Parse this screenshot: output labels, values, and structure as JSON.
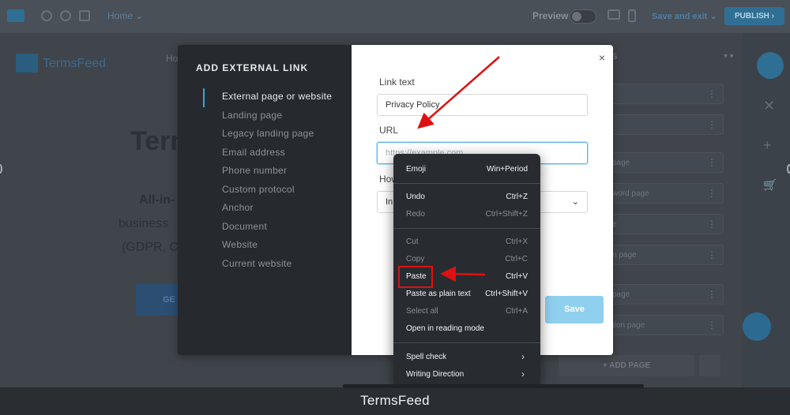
{
  "topbar": {
    "home_label": "Home",
    "preview_label": "Preview",
    "save_exit_label": "Save and exit",
    "publish_label": "PUBLISH"
  },
  "site": {
    "logo_text": "TermsFeed",
    "nav_text": "Ho",
    "hero_title": "Term",
    "hero_sub1": "All-in-",
    "hero_sub2": "business",
    "hero_sub3": "(GDPR, C",
    "hero_button": "GE"
  },
  "pages_panel": {
    "header": "S",
    "items": [
      {
        "label": ""
      },
      {
        "label": ""
      },
      {
        "label": "page"
      },
      {
        "label": "word page"
      },
      {
        "label": "e"
      },
      {
        "label": "n page"
      },
      {
        "label": "page"
      },
      {
        "label": "tion page"
      }
    ],
    "add_page_label": "+ ADD PAGE"
  },
  "modal": {
    "title": "ADD EXTERNAL LINK",
    "nav_items": [
      "External page or website",
      "Landing page",
      "Legacy landing page",
      "Email address",
      "Phone number",
      "Custom protocol",
      "Anchor",
      "Document",
      "Website",
      "Current website"
    ],
    "link_text_label": "Link text",
    "link_text_value": "Privacy Policy",
    "url_label": "URL",
    "url_placeholder": "https://example.com",
    "how_label": "How",
    "how_value": "In",
    "save_label": "Save",
    "close_glyph": "×"
  },
  "context_menu": {
    "items": [
      {
        "label": "Emoji",
        "shortcut": "Win+Period",
        "enabled": true
      },
      {
        "label": "Undo",
        "shortcut": "Ctrl+Z",
        "enabled": true
      },
      {
        "label": "Redo",
        "shortcut": "Ctrl+Shift+Z",
        "enabled": false
      },
      {
        "label": "Cut",
        "shortcut": "Ctrl+X",
        "enabled": false
      },
      {
        "label": "Copy",
        "shortcut": "Ctrl+C",
        "enabled": false
      },
      {
        "label": "Paste",
        "shortcut": "Ctrl+V",
        "enabled": true
      },
      {
        "label": "Paste as plain text",
        "shortcut": "Ctrl+Shift+V",
        "enabled": true
      },
      {
        "label": "Select all",
        "shortcut": "Ctrl+A",
        "enabled": false
      },
      {
        "label": "Open in reading mode",
        "shortcut": "",
        "enabled": true
      },
      {
        "label": "Spell check",
        "shortcut": "",
        "enabled": true
      },
      {
        "label": "Writing Direction",
        "shortcut": "",
        "enabled": true
      }
    ]
  },
  "annotation_color": "#e01010",
  "accent_color": "#3da4d6",
  "caption": "TermsFeed"
}
